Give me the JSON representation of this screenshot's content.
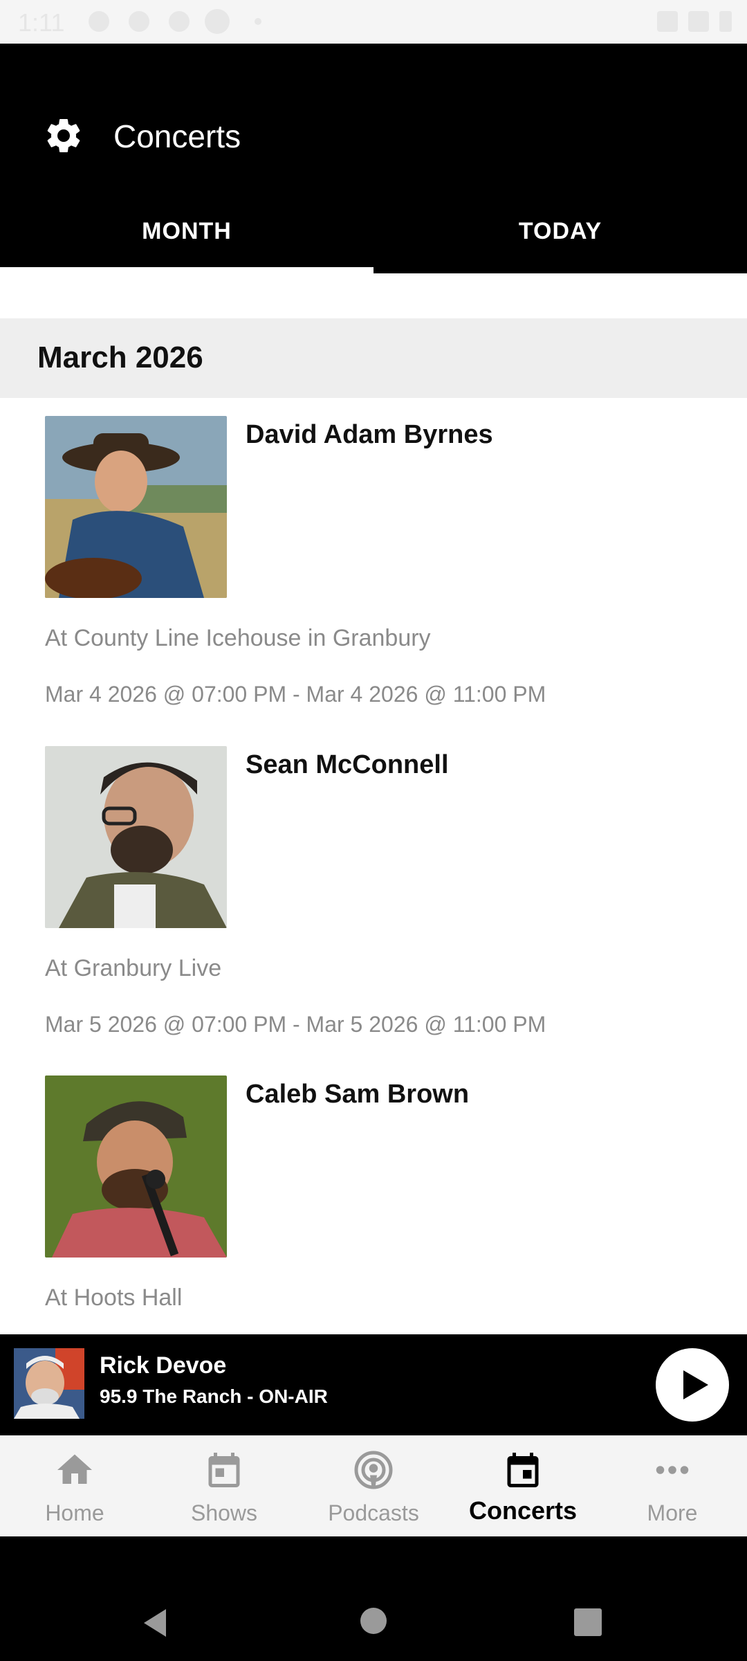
{
  "status_bar": {
    "time": "1:11"
  },
  "app_bar": {
    "title": "Concerts"
  },
  "tabs": [
    {
      "label": "MONTH",
      "selected": true
    },
    {
      "label": "TODAY",
      "selected": false
    }
  ],
  "month_header": "March 2026",
  "events": [
    {
      "name": "David Adam Byrnes",
      "venue": "At County Line Icehouse in Granbury",
      "time": "Mar 4 2026 @ 07:00 PM - Mar 4 2026 @ 11:00 PM"
    },
    {
      "name": "Sean McConnell",
      "venue": "At Granbury Live",
      "time": "Mar 5 2026 @ 07:00 PM - Mar 5 2026 @ 11:00 PM"
    },
    {
      "name": "Caleb Sam Brown",
      "venue": "At Hoots Hall"
    }
  ],
  "player": {
    "title": "Rick Devoe",
    "subtitle": "95.9 The Ranch - ON-AIR"
  },
  "bottom_nav": [
    {
      "label": "Home",
      "icon": "home-icon"
    },
    {
      "label": "Shows",
      "icon": "calendar-icon"
    },
    {
      "label": "Podcasts",
      "icon": "podcast-icon"
    },
    {
      "label": "Concerts",
      "icon": "calendar-icon",
      "active": true
    },
    {
      "label": "More",
      "icon": "more-icon"
    }
  ],
  "colors": {
    "app_bar": "#000000",
    "accent": "#ffffff",
    "muted_text": "#8a8a8a",
    "nav_active": "#000000",
    "nav_inactive": "#9a9a9a"
  }
}
